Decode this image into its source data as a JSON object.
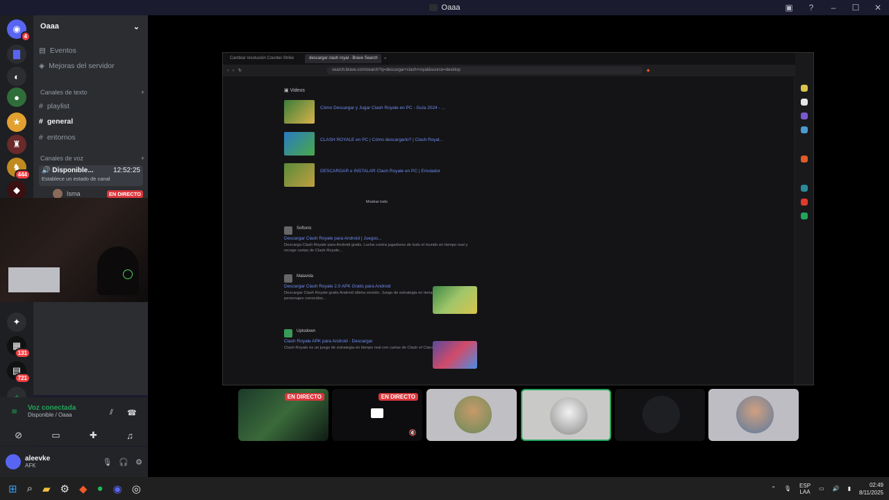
{
  "window": {
    "title": "Oaaa",
    "controls": [
      "inbox-icon",
      "help-icon",
      "minimize",
      "maximize",
      "close"
    ]
  },
  "servers": [
    {
      "icon": "discord-icon",
      "badge": "4"
    },
    {
      "icon": "folder-icon"
    },
    {
      "icon": "server-2"
    },
    {
      "icon": "server-3"
    },
    {
      "icon": "server-4"
    },
    {
      "icon": "server-5"
    },
    {
      "icon": "server-6",
      "badge": "444"
    },
    {
      "icon": "server-7"
    },
    {
      "icon": "server-8"
    },
    {
      "icon": "server-9",
      "badge": "131"
    },
    {
      "icon": "server-10",
      "badge": "721"
    },
    {
      "icon": "add-server-icon"
    }
  ],
  "channels": {
    "server_name": "Oaaa",
    "top_items": [
      "Eventos",
      "Mejoras del servidor"
    ],
    "text_category": "Canales de texto",
    "text_channels": [
      "playlist",
      "general",
      "entornos"
    ],
    "voice_category": "Canales de voz",
    "voice_channel": {
      "name": "Disponible...",
      "time": "12:52:25",
      "status": "Establece un estado de canal"
    },
    "member": {
      "name": "Isma",
      "live": "EN DIRECTO"
    }
  },
  "voice_connected": {
    "title": "Voz conectada",
    "subtitle": "Disponible / Oaaa"
  },
  "user": {
    "name": "aleevke",
    "status": "AFK"
  },
  "browser": {
    "tabs": [
      "Cambiar resolución Counter-Strike",
      "descargar clash royal - Brave Search"
    ],
    "url": "search.brave.com/search?q=descargar+clash+royal&source=desktop",
    "videos_label": "Videos",
    "videos": [
      {
        "title": "Cómo Descargar y Jugar Clash Royale en PC - Guía 2024 - ..."
      },
      {
        "title": "CLASH ROYALE en PC | Cómo descargarlo? | Clash Royal..."
      },
      {
        "title": "DESCARGAR e INSTALAR Clash Royale en PC | Emulador"
      }
    ],
    "show_all": "Mostrar todo",
    "results": [
      {
        "source": "Softonic",
        "title": "Descargar Clash Royale para Android | Juegos...",
        "desc": "Descarga Clash Royale para Android gratis. Lucha contra jugadores de todo el mundo en tiempo real y recoge cartas de Clash Royale..."
      },
      {
        "source": "Malavida",
        "title": "Descargar Clash Royale 2.0 APK Gratis para Android",
        "desc": "Descargar Clash Royale gratis Android última versión. Juego de estrategia en tiempo real con cartas de personajes conocidos..."
      },
      {
        "source": "Uptodown",
        "title": "Clash Royale APK para Android - Descargar",
        "desc": "Clash Royale es un juego de estrategia en tiempo real con cartas de Clash of Clans..."
      }
    ]
  },
  "stream_tiles": [
    {
      "name": "stream-1",
      "live": "EN DIRECTO"
    },
    {
      "name": "stream-2",
      "live": "EN DIRECTO"
    },
    {
      "name": "user-tile-3"
    },
    {
      "name": "user-tile-4"
    },
    {
      "name": "user-tile-5"
    },
    {
      "name": "user-tile-6"
    }
  ],
  "taskbar": {
    "lang": "ESP",
    "region": "LAA",
    "time": "02:49",
    "date": "8/11/2025"
  },
  "colors": {
    "accent": "#5865f2",
    "live": "#da373c",
    "connected": "#23a55a",
    "link": "#6e8cf0"
  }
}
